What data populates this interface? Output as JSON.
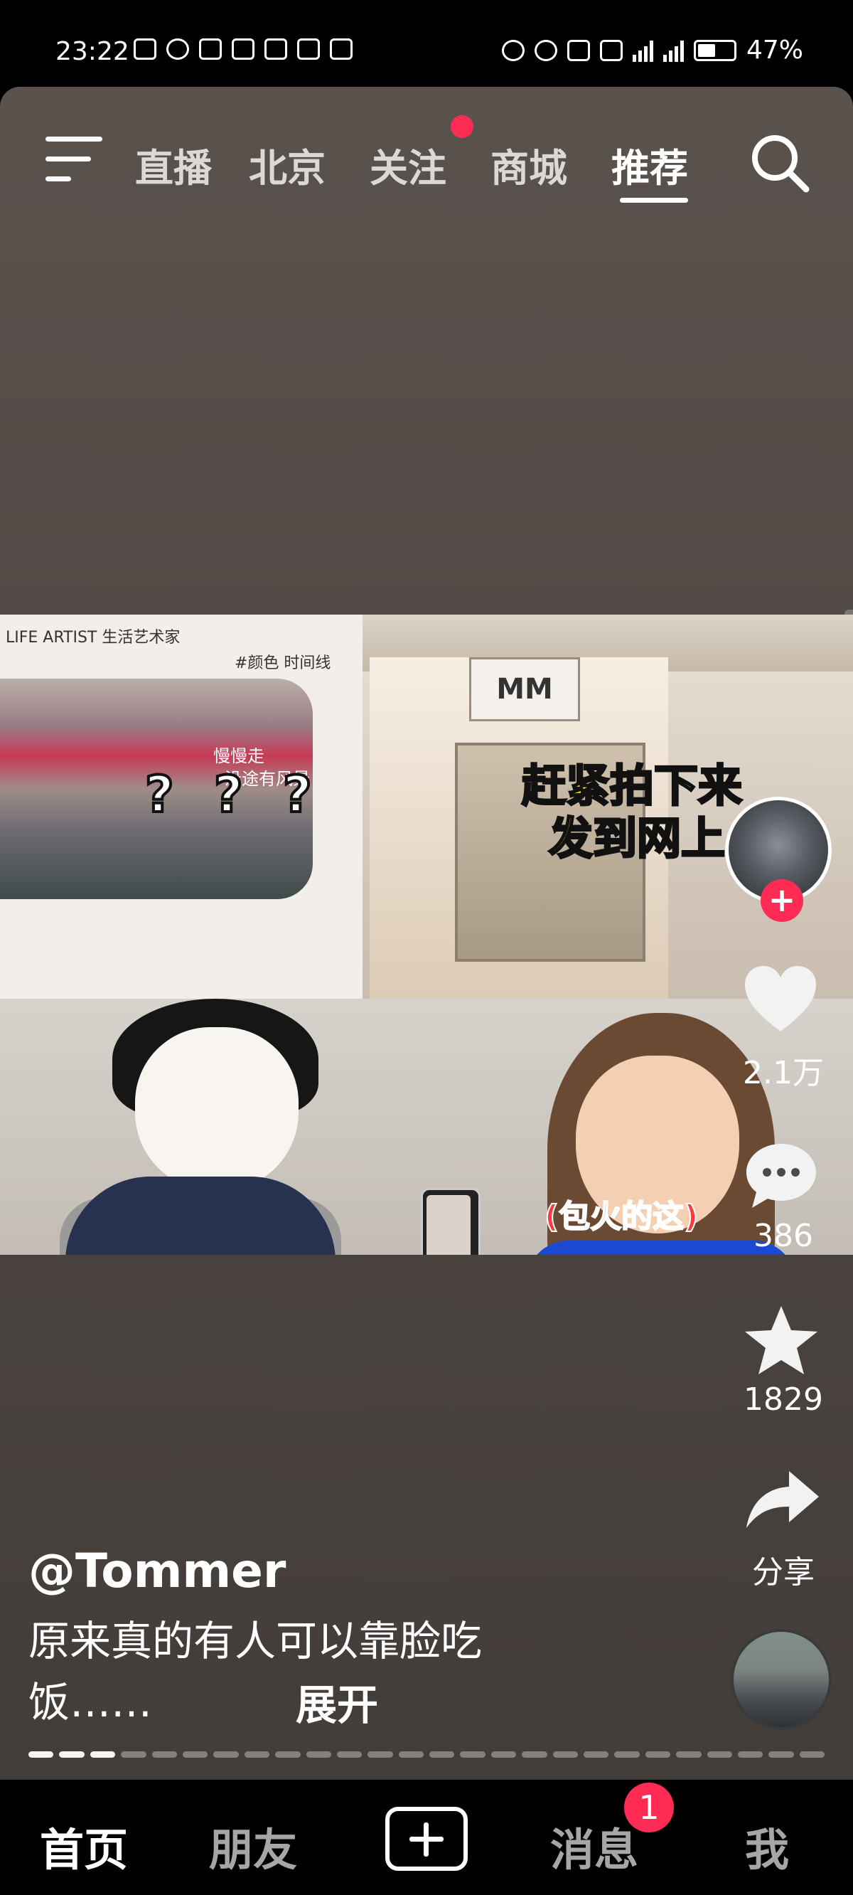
{
  "status_bar": {
    "time": "23:22",
    "battery": "47%",
    "icons": [
      "cast-icon",
      "eye-icon",
      "nfc-icon",
      "link-icon",
      "app-icon",
      "app-icon",
      "link-icon",
      "alarm-icon",
      "headphone-icon",
      "battery-saver-icon",
      "mute-icon",
      "signal-5g-icon",
      "signal-5g-icon",
      "battery-icon"
    ]
  },
  "top_nav": {
    "tabs": [
      "直播",
      "北京",
      "关注",
      "商城",
      "推荐"
    ],
    "active_tab": "推荐"
  },
  "video": {
    "question_marks": "? ? ?",
    "caption_line1": "赶紧拍下来",
    "caption_line2": "发到网上",
    "caption_bottom": "(包火的这)",
    "screen_text_1": "慢慢走",
    "screen_text_2": "沿途有风景",
    "brand_text_1": "LIFE ARTIST 生活艺术家",
    "brand_text_2": "#颜色 时间线",
    "store_sign": "MM"
  },
  "actions": {
    "likes": "2.1万",
    "comments": "386",
    "favorites": "1829",
    "share": "分享"
  },
  "post": {
    "author": "@Tommer",
    "description": "原来真的有人可以靠脸吃饭……",
    "desc_line1": "原来真的有人可以靠脸吃",
    "desc_line2": "饭……",
    "expand": "展开"
  },
  "progress": {
    "total_segments": 26,
    "completed_segments": 3
  },
  "bottom_nav": {
    "home": "首页",
    "friends": "朋友",
    "messages": "消息",
    "me": "我",
    "message_badge": "1",
    "active": "首页"
  },
  "colors": {
    "accent": "#fe2c55",
    "caption_yellow": "#fde23a",
    "background": "#4f4844"
  }
}
